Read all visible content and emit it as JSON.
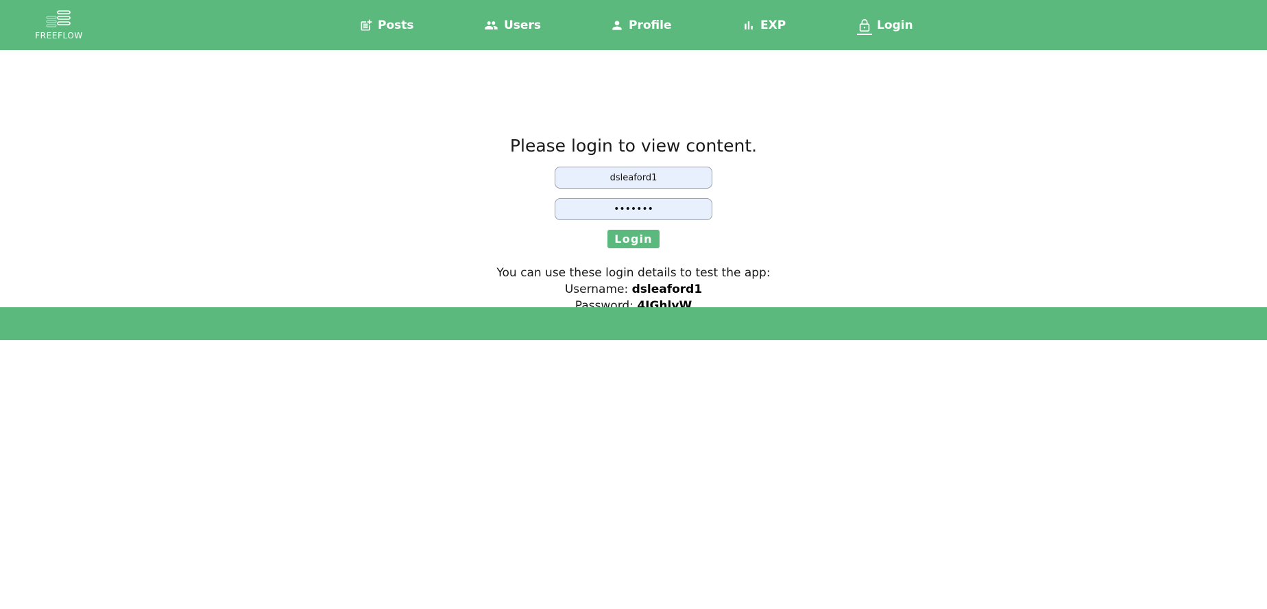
{
  "brand": {
    "name": "FREEFLOW",
    "icon": "stacked-bars-logo-icon"
  },
  "nav": {
    "items": [
      {
        "label": "Posts",
        "icon": "post-add-icon"
      },
      {
        "label": "Users",
        "icon": "users-icon"
      },
      {
        "label": "Profile",
        "icon": "person-icon"
      },
      {
        "label": "EXP",
        "icon": "bar-chart-icon"
      },
      {
        "label": "Login",
        "icon": "lock-icon",
        "active": true
      }
    ]
  },
  "login": {
    "heading": "Please login to view content.",
    "username_value": "dsleaford1",
    "password_value": "4IGhlyW",
    "button_label": "Login"
  },
  "hint": {
    "intro": "You can use these login details to test the app:",
    "username_label": "Username:",
    "username": "dsleaford1",
    "password_label": "Password:",
    "password": "4IGhlyW"
  },
  "colors": {
    "accent": "#5cb97d",
    "input_bg": "#e8f0fe"
  }
}
